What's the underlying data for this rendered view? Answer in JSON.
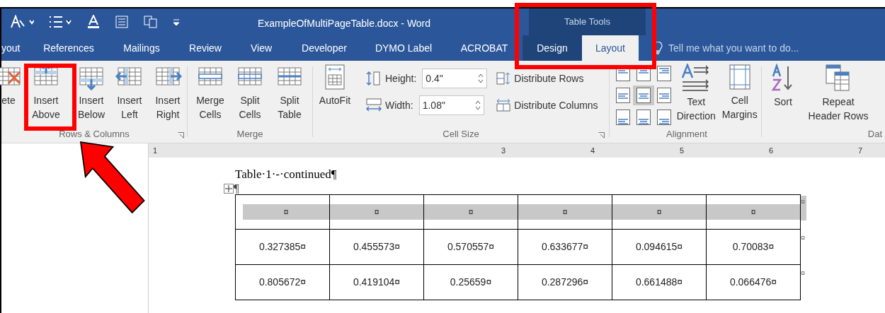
{
  "window": {
    "title": "ExampleOfMultiPageTable.docx - Word",
    "context_title": "Table Tools"
  },
  "tabs": [
    {
      "label": "yout",
      "selected": false
    },
    {
      "label": "References",
      "selected": false
    },
    {
      "label": "Mailings",
      "selected": false
    },
    {
      "label": "Review",
      "selected": false
    },
    {
      "label": "View",
      "selected": false
    },
    {
      "label": "Developer",
      "selected": false
    },
    {
      "label": "DYMO Label",
      "selected": false
    },
    {
      "label": "ACROBAT",
      "selected": false
    },
    {
      "label": "Design",
      "selected": false,
      "kind": "context"
    },
    {
      "label": "Layout",
      "selected": true,
      "kind": "context"
    }
  ],
  "tell_me": {
    "placeholder": "Tell me what you want to do..."
  },
  "ribbon": {
    "rows_columns": {
      "label": "Rows & Columns",
      "buttons": [
        {
          "kind": "delete",
          "label": "ete"
        },
        {
          "kind": "above",
          "label": "Insert Above"
        },
        {
          "kind": "below",
          "label": "Insert Below"
        },
        {
          "kind": "left",
          "label": "Insert Left"
        },
        {
          "kind": "right",
          "label": "Insert Right"
        }
      ]
    },
    "merge": {
      "label": "Merge",
      "buttons": [
        {
          "kind": "merge",
          "label": "Merge Cells"
        },
        {
          "kind": "split",
          "label": "Split Cells"
        },
        {
          "kind": "splittable",
          "label": "Split Table"
        }
      ]
    },
    "cell_size": {
      "label": "Cell Size",
      "autofit": "AutoFit",
      "height": {
        "label": "Height:",
        "value": "0.4\""
      },
      "width": {
        "label": "Width:",
        "value": "1.08\""
      },
      "distribute_rows": "Distribute Rows",
      "distribute_columns": "Distribute Columns"
    },
    "alignment": {
      "label": "Alignment",
      "buttons": [
        {
          "selected": false
        },
        {
          "selected": false
        },
        {
          "selected": false
        },
        {
          "selected": false
        },
        {
          "selected": true
        },
        {
          "selected": false
        },
        {
          "selected": false
        },
        {
          "selected": false
        },
        {
          "selected": false
        }
      ],
      "text_direction": "Text Direction",
      "cell_margins": "Cell Margins"
    },
    "data": {
      "label": "Dat",
      "sort": "Sort",
      "repeat_header_rows": "Repeat Header Rows"
    }
  },
  "ruler": [
    "1",
    "3",
    "4",
    "5",
    "6",
    "7"
  ],
  "document": {
    "caption": "Table·1·-·continued¶",
    "paragraph_mark": "¶",
    "end_mark": "¤",
    "table": {
      "header": [
        "¤",
        "¤",
        "¤",
        "¤",
        "¤",
        "¤"
      ],
      "rows": [
        [
          "0.327385¤",
          "0.455573¤",
          "0.570557¤",
          "0.633677¤",
          "0.094615¤",
          "0.70083¤"
        ],
        [
          "0.805672¤",
          "0.419104¤",
          "0.25659¤",
          "0.287296¤",
          "0.661488¤",
          "0.066476¤"
        ]
      ]
    }
  }
}
